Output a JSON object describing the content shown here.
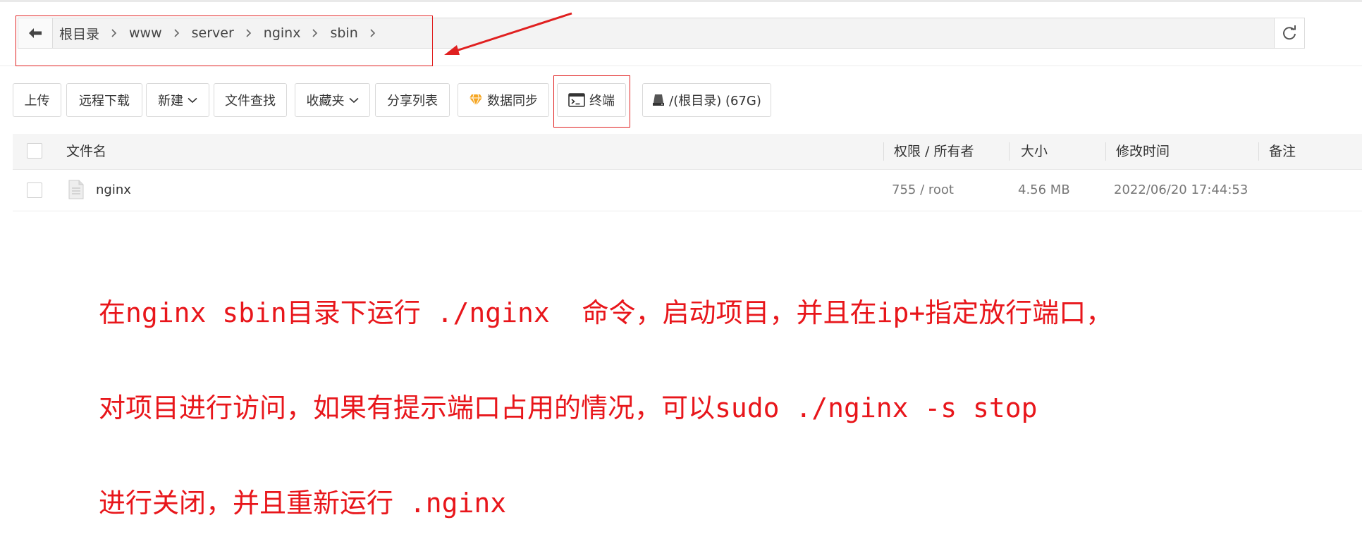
{
  "breadcrumb": {
    "items": [
      "根目录",
      "www",
      "server",
      "nginx",
      "sbin"
    ]
  },
  "toolbar": {
    "buttons": [
      {
        "label": "上传"
      },
      {
        "label": "远程下载"
      },
      {
        "label": "新建"
      },
      {
        "label": "文件查找"
      },
      {
        "label": "收藏夹"
      },
      {
        "label": "分享列表"
      },
      {
        "label": "数据同步"
      },
      {
        "label": "终端"
      },
      {
        "label": "/(根目录) (67G)"
      }
    ]
  },
  "table": {
    "headers": [
      "文件名",
      "权限 / 所有者",
      "大小",
      "修改时间",
      "备注"
    ],
    "rows": [
      {
        "name": "nginx",
        "perm": "755 / root",
        "size": "4.56 MB",
        "mtime": "2022/06/20 17:44:53",
        "note": ""
      }
    ]
  },
  "annotation": {
    "lines": [
      "在nginx sbin目录下运行 ./nginx  命令，启动项目，并且在ip+指定放行端口，",
      "对项目进行访问，如果有提示端口占用的情况，可以sudo ./nginx -s stop",
      "进行关闭，并且重新运行 .nginx"
    ]
  },
  "colors": {
    "annotation_red": "#e02020",
    "diamond_orange": "#f5a623"
  }
}
